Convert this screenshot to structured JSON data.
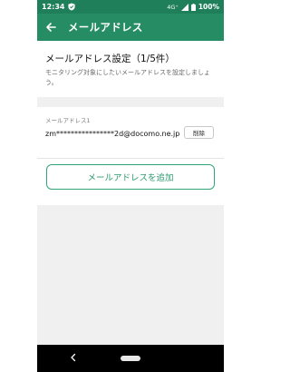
{
  "status_bar": {
    "time": "12:34",
    "network": "4G⁺",
    "battery": "100%"
  },
  "app_bar": {
    "title": "メールアドレス"
  },
  "settings": {
    "heading": "メールアドレス設定（1/5件）",
    "description": "モニタリング対象にしたいメールアドレスを設定しましょう。"
  },
  "email_entry": {
    "label": "メールアドレス1",
    "value": "zm****************2d@docomo.ne.jp",
    "delete_label": "削除"
  },
  "add_button": {
    "label": "メールアドレスを追加"
  },
  "colors": {
    "status_bar": "#1e7f5a",
    "app_bar": "#268c63",
    "accent": "#2e9b6f"
  }
}
